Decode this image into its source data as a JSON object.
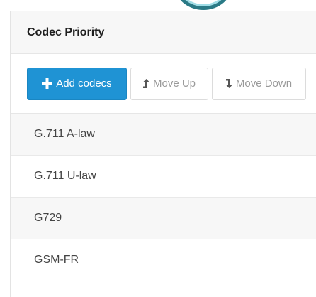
{
  "panel": {
    "title": "Codec Priority"
  },
  "toolbar": {
    "add_label": "Add codecs",
    "add_icon": "plus-icon",
    "move_up_label": "Move Up",
    "move_up_icon": "arrow-up-icon",
    "move_down_label": "Move Down",
    "move_down_icon": "arrow-down-icon"
  },
  "codecs": [
    {
      "name": "G.711 A-law"
    },
    {
      "name": "G.711 U-law"
    },
    {
      "name": "G729"
    },
    {
      "name": "GSM-FR"
    }
  ],
  "colors": {
    "primary": "#1f93d4",
    "header_bg": "#f7f7f7",
    "border": "#e3e3e3"
  }
}
